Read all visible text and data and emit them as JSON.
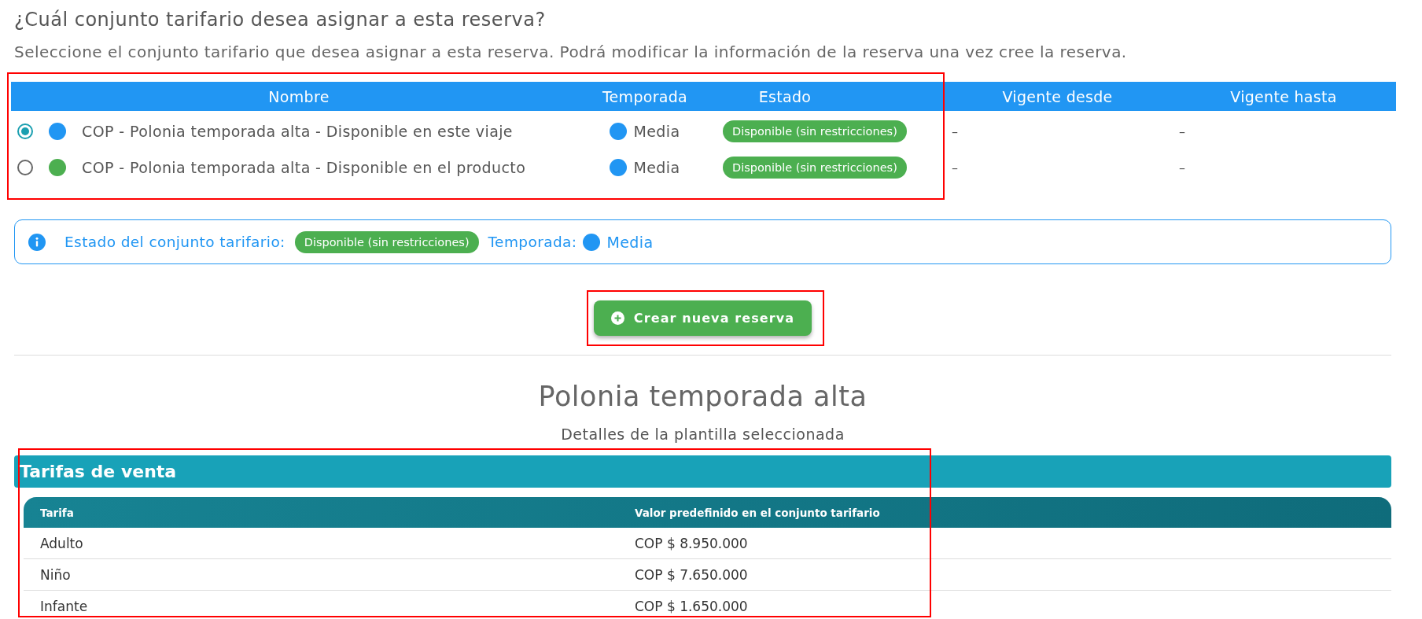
{
  "question": {
    "title": "¿Cuál conjunto tarifario desea asignar a esta reserva?",
    "description": "Seleccione el conjunto tarifario que desea asignar a esta reserva. Podrá modificar la información de la reserva una vez cree la reserva."
  },
  "fare_sets": {
    "highlighted": true,
    "columns": [
      "Nombre",
      "Temporada",
      "Estado",
      "Vigente desde",
      "Vigente hasta"
    ],
    "rows": [
      {
        "selected": true,
        "color": "#2196f3",
        "name": "COP - Polonia temporada alta - Disponible en este viaje",
        "season": {
          "label": "Media",
          "color": "#2196f3"
        },
        "status": "Disponible (sin restricciones)",
        "valid_from": "–",
        "valid_to": "–"
      },
      {
        "selected": false,
        "color": "#4caf50",
        "name": "COP - Polonia temporada alta - Disponible en el producto",
        "season": {
          "label": "Media",
          "color": "#2196f3"
        },
        "status": "Disponible (sin restricciones)",
        "valid_from": "–",
        "valid_to": "–"
      }
    ]
  },
  "info_bar": {
    "status_label": "Estado del conjunto tarifario:",
    "status": "Disponible (sin restricciones)",
    "season_label": "Temporada:",
    "season": {
      "label": "Media",
      "color": "#2196f3"
    }
  },
  "create_button": {
    "label": "Crear nueva reserva",
    "highlighted": true
  },
  "template": {
    "title": "Polonia temporada alta",
    "subtitle": "Detalles de la plantilla seleccionada",
    "section": {
      "title": "Tarifas de venta",
      "highlighted": true,
      "columns": [
        "Tarifa",
        "Valor predefinido en el conjunto tarifario"
      ],
      "rows": [
        [
          "Adulto",
          "COP $ 8.950.000"
        ],
        [
          "Niño",
          "COP $ 7.650.000"
        ],
        [
          "Infante",
          "COP $ 1.650.000"
        ]
      ]
    }
  }
}
